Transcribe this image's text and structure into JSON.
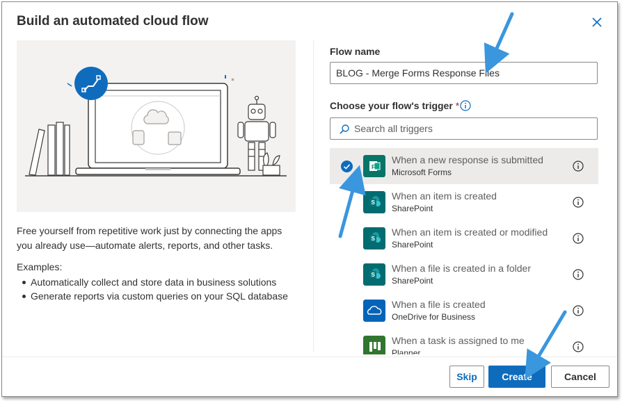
{
  "dialog": {
    "title": "Build an automated cloud flow",
    "description": "Free yourself from repetitive work just by connecting the apps you already use—automate alerts, reports, and other tasks.",
    "examples_title": "Examples:",
    "examples": [
      "Automatically collect and store data in business solutions",
      "Generate reports via custom queries on your SQL database"
    ]
  },
  "form": {
    "flow_name_label": "Flow name",
    "flow_name_value": "BLOG - Merge Forms Response Files",
    "trigger_label": "Choose your flow's trigger",
    "required_mark": "*",
    "search_placeholder": "Search all triggers"
  },
  "triggers": [
    {
      "name": "When a new response is submitted",
      "app": "Microsoft Forms",
      "icon": "forms-icon",
      "selected": true
    },
    {
      "name": "When an item is created",
      "app": "SharePoint",
      "icon": "sharepoint-icon",
      "selected": false
    },
    {
      "name": "When an item is created or modified",
      "app": "SharePoint",
      "icon": "sharepoint-icon",
      "selected": false
    },
    {
      "name": "When a file is created in a folder",
      "app": "SharePoint",
      "icon": "sharepoint-icon",
      "selected": false
    },
    {
      "name": "When a file is created",
      "app": "OneDrive for Business",
      "icon": "onedrive-icon",
      "selected": false
    },
    {
      "name": "When a task is assigned to me",
      "app": "Planner",
      "icon": "planner-icon",
      "selected": false
    }
  ],
  "buttons": {
    "skip": "Skip",
    "create": "Create",
    "cancel": "Cancel"
  },
  "colors": {
    "accent": "#0f6cbd",
    "annotation_arrow": "#3a96dd",
    "forms": "#077568",
    "sharepoint": "#036c70",
    "onedrive": "#0364b8",
    "planner": "#31752f"
  }
}
